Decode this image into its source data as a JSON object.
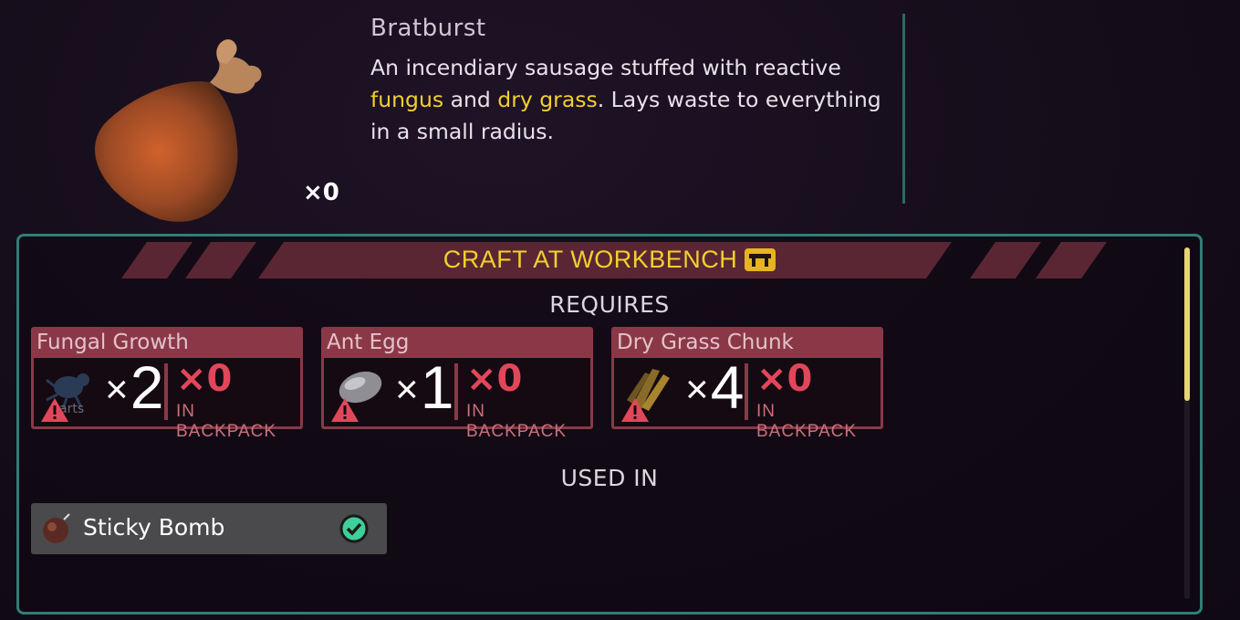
{
  "item": {
    "name": "Bratburst",
    "count": "×0",
    "description_parts": {
      "p1": "An incendiary sausage stuffed with reactive ",
      "hl1": "fungus",
      "p2": " and ",
      "hl2": "dry grass",
      "p3": ". Lays waste to everything in a small radius."
    },
    "image_icon": "sausage-sack-icon"
  },
  "craft": {
    "banner": "CRAFT AT WORKBENCH",
    "banner_icon": "workbench-icon",
    "requires_label": "REQUIRES",
    "requirements": [
      {
        "name": "Fungal Growth",
        "icon": "fungal-growth-icon",
        "qty_x": "×",
        "qty": "2",
        "have": "×0",
        "backpack_label": "IN BACKPACK",
        "icon_caption": "arts"
      },
      {
        "name": "Ant Egg",
        "icon": "ant-egg-icon",
        "qty_x": "×",
        "qty": "1",
        "have": "×0",
        "backpack_label": "IN BACKPACK"
      },
      {
        "name": "Dry Grass Chunk",
        "icon": "dry-grass-chunk-icon",
        "qty_x": "×",
        "qty": "4",
        "have": "×0",
        "backpack_label": "IN BACKPACK"
      }
    ],
    "used_in_label": "USED IN",
    "used_in": [
      {
        "label": "Sticky Bomb",
        "icon": "sticky-bomb-icon",
        "status_icon": "check-icon"
      }
    ]
  },
  "colors": {
    "accent_yellow": "#f2d02c",
    "card_red": "#8a3848",
    "missing_red": "#e2465a",
    "panel_border": "#2e7f76",
    "check_green": "#3ecf9a"
  }
}
